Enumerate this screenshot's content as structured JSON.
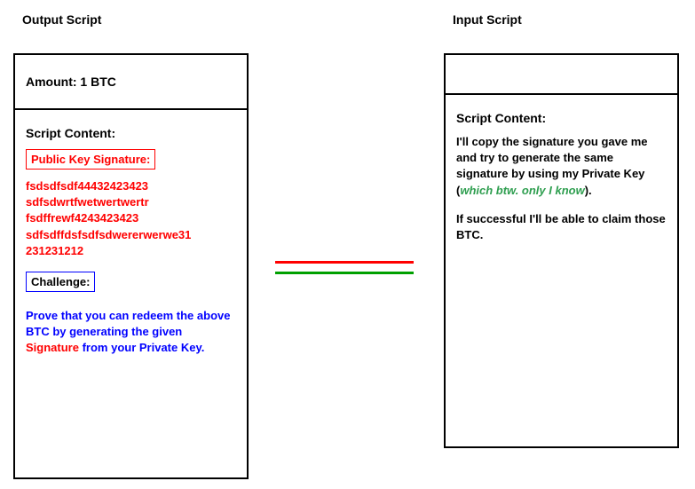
{
  "titles": {
    "left": "Output Script",
    "right": "Input Script"
  },
  "left_panel": {
    "amount_label": "Amount: 1 BTC",
    "script_content_label": "Script Content:",
    "pubkey_label": "Public Key Signature:",
    "signature_lines": {
      "l1": "fsdsdfsdf44432423423",
      "l2": "sdfsdwrtfwetwertwertr",
      "l3": "fsdffrewf4243423423",
      "l4": "sdfsdffdsfsdfsdwererwerwe31",
      "l5": "231231212"
    },
    "challenge_label": "Challenge:",
    "challenge_text_pre": "Prove that you can redeem the above BTC by generating the given ",
    "challenge_sig_word": "Signature",
    "challenge_text_post": " from your Private Key."
  },
  "right_panel": {
    "script_content_label": "Script Content:",
    "p1_pre": "I'll copy the signature you gave me and try to generate the same signature by using my Private Key (",
    "p1_italic": "which btw. only I know",
    "p1_post": ").",
    "p2": "If successful I'll be able to claim those BTC."
  }
}
